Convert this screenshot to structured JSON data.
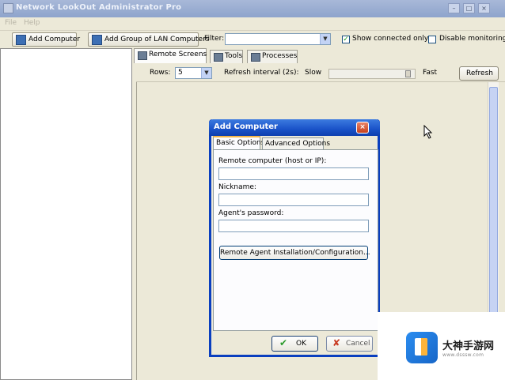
{
  "window": {
    "title": "Network LookOut Administrator Pro",
    "controls": [
      "minimize",
      "maximize",
      "close"
    ]
  },
  "menubar": {
    "items": [
      "File",
      "Help"
    ]
  },
  "toolbar": {
    "add_computer": "Add Computer",
    "add_group": "Add Group of LAN Computers",
    "filter_label": "Filter:",
    "filter_value": "",
    "show_connected_only": "Show connected only",
    "show_connected_checked": true,
    "disable_monitoring": "Disable monitoring",
    "disable_monitoring_checked": false
  },
  "tabs": [
    {
      "label": "Remote Screens",
      "active": true
    },
    {
      "label": "Tools",
      "active": false
    },
    {
      "label": "Processes",
      "active": false
    }
  ],
  "options_bar": {
    "rows_label": "Rows:",
    "rows_value": "5",
    "refresh_interval_label": "Refresh interval (2s):",
    "slow_label": "Slow",
    "fast_label": "Fast",
    "refresh_button": "Refresh"
  },
  "dialog": {
    "title": "Add Computer",
    "tabs": [
      {
        "label": "Basic Options",
        "active": true
      },
      {
        "label": "Advanced Options",
        "active": false
      }
    ],
    "remote_computer_label": "Remote computer (host or IP):",
    "remote_computer_value": "",
    "nickname_label": "Nickname:",
    "nickname_value": "",
    "password_label": "Agent's password:",
    "password_value": "",
    "install_button": "Remote Agent Installation/Configuration...",
    "ok_button": "OK",
    "cancel_button": "Cancel"
  },
  "watermark": {
    "name": "大神手游网",
    "url": "www.dsssw.com"
  },
  "colors": {
    "dialog_title": "#1a52c8",
    "window_bg": "#ece9d8",
    "checkbox_tick": "#21a121"
  }
}
